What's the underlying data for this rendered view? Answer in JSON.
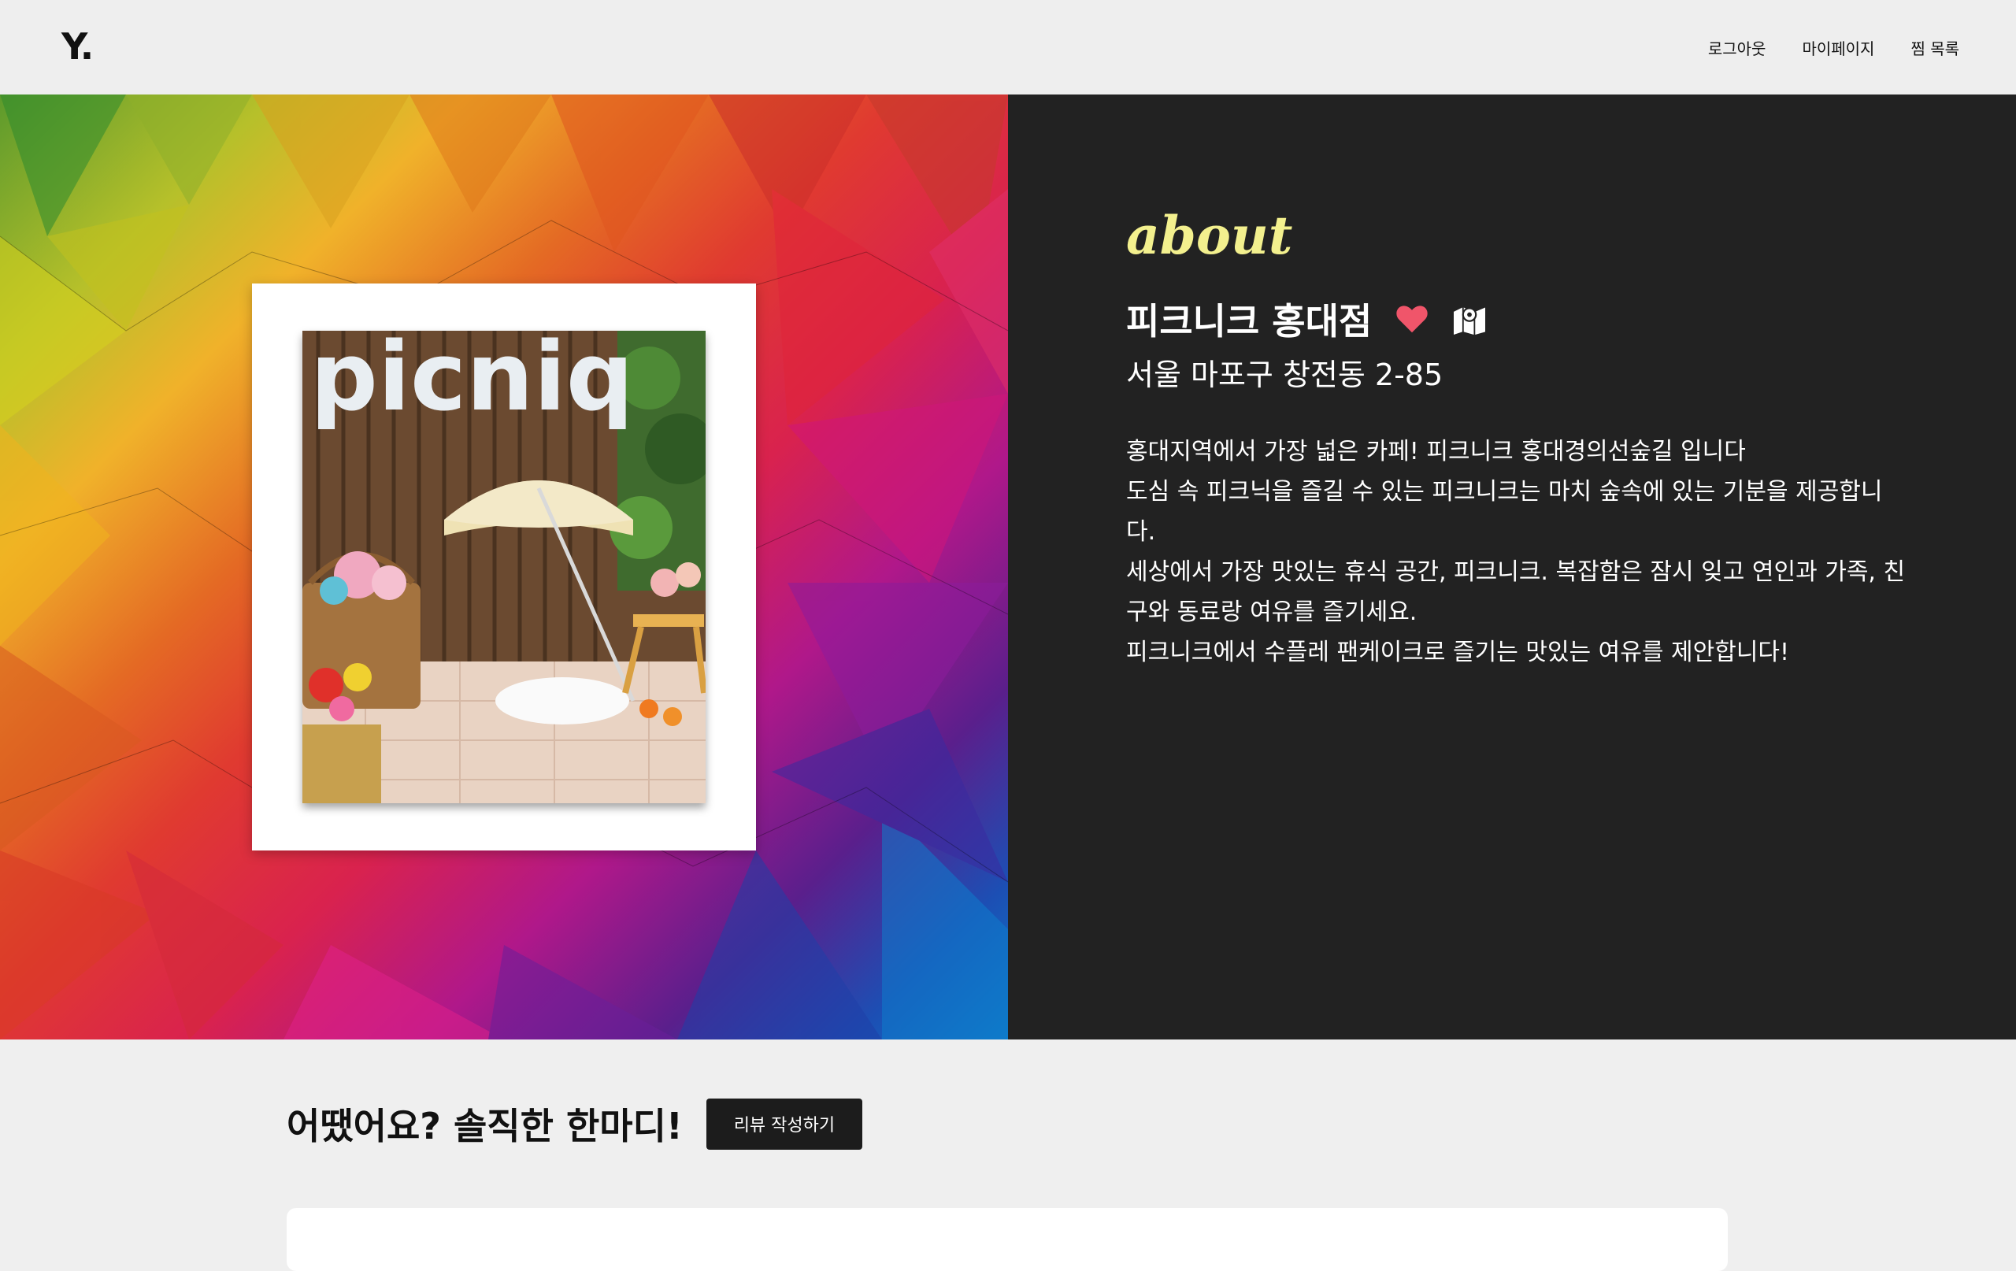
{
  "header": {
    "logo": "Y.",
    "nav": [
      "로그아웃",
      "마이페이지",
      "찜 목록"
    ]
  },
  "hero": {
    "photo_sign_text": "picniq",
    "about_label": "about",
    "place_name": "피크니크 홍대점",
    "address": "서울 마포구 창전동 2-85",
    "description": [
      "홍대지역에서 가장 넓은 카페! 피크니크 홍대경의선숲길 입니다",
      "도심 속 피크닉을 즐길 수 있는 피크니크는 마치 숲속에 있는 기분을 제공합니다.",
      "세상에서 가장 맛있는 휴식 공간, 피크니크. 복잡함은 잠시 잊고 연인과 가족, 친구와 동료랑 여유를 즐기세요.",
      "피크니크에서 수플레 팬케이크로 즐기는 맛있는 여유를 제안합니다!"
    ],
    "icons": {
      "favorite": "heart-icon",
      "map": "map-icon"
    },
    "colors": {
      "about": "#f3f08e",
      "heart": "#f0556a",
      "panel": "#222222"
    }
  },
  "reviews": {
    "title": "어땠어요? 솔직한 한마디!",
    "write_button": "리뷰 작성하기"
  }
}
